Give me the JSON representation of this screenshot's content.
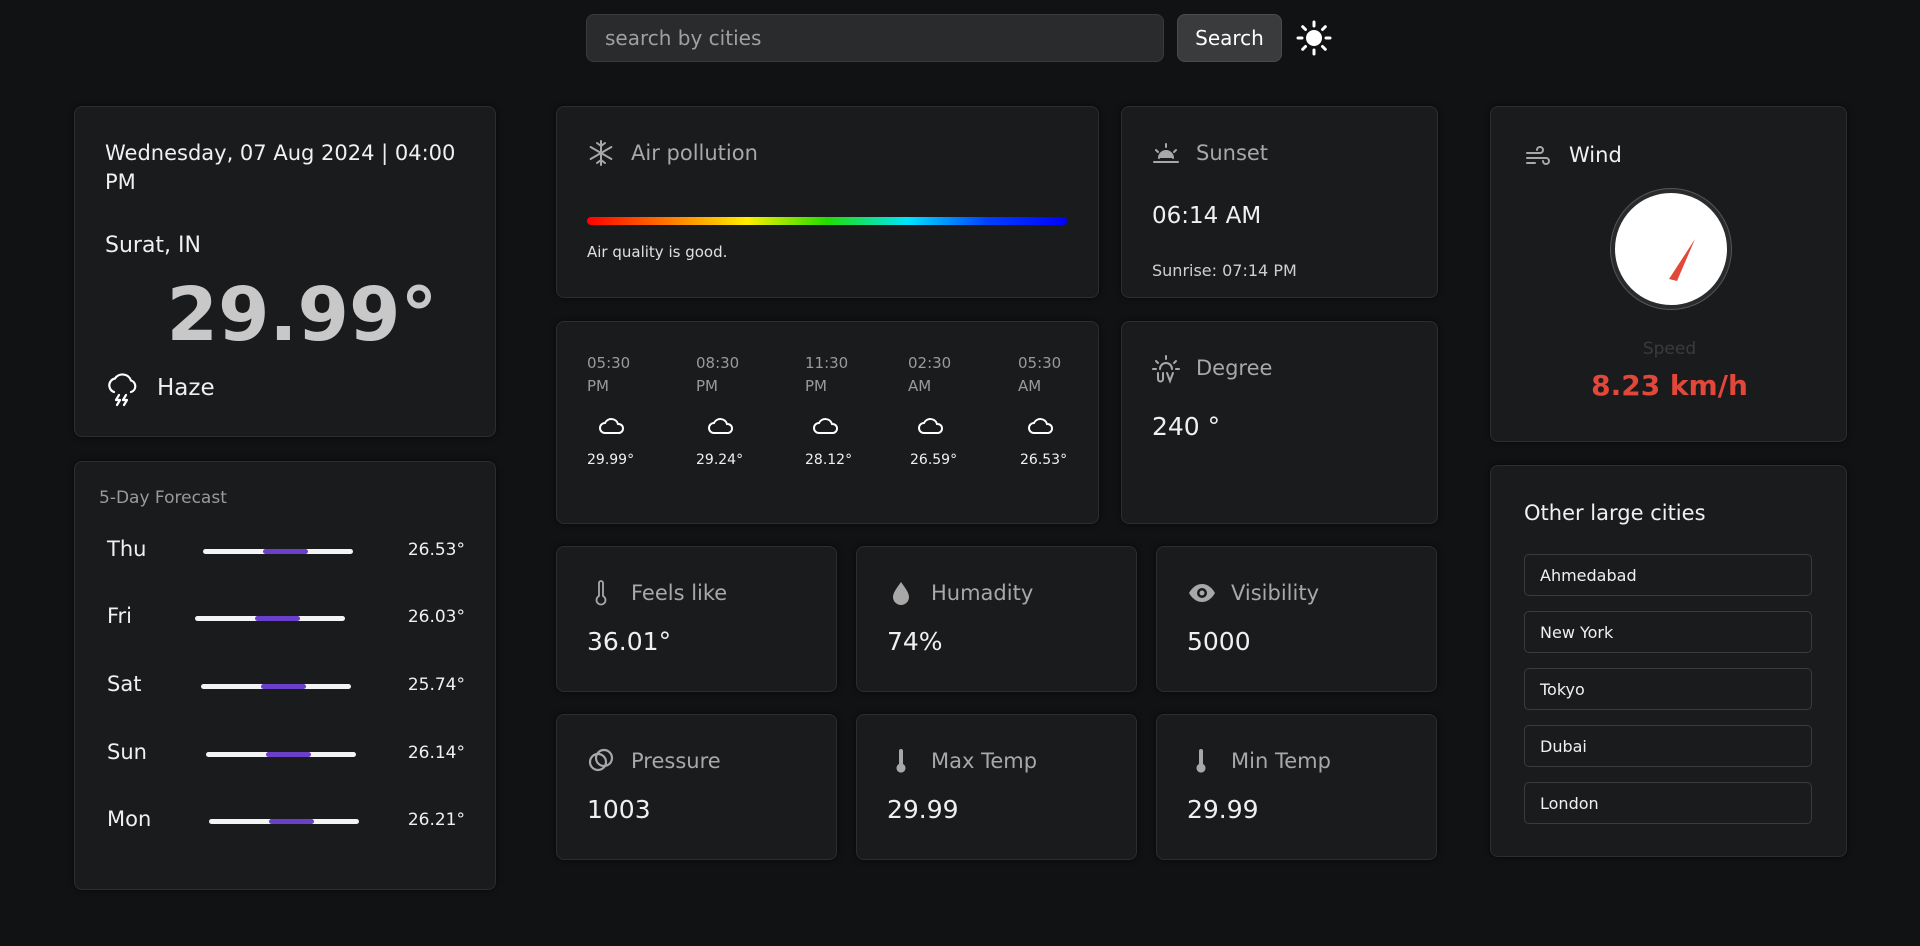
{
  "search": {
    "placeholder": "search by cities",
    "button_label": "Search"
  },
  "current": {
    "datetime": "Wednesday, 07 Aug 2024 | 04:00 PM",
    "location": "Surat, IN",
    "temperature": "29.99°",
    "condition": "Haze",
    "condition_icon": "cloud-storm-icon"
  },
  "forecast": {
    "title": "5-Day Forecast",
    "days": [
      {
        "day": "Thu",
        "temp": "26.53°"
      },
      {
        "day": "Fri",
        "temp": "26.03°"
      },
      {
        "day": "Sat",
        "temp": "25.74°"
      },
      {
        "day": "Sun",
        "temp": "26.14°"
      },
      {
        "day": "Mon",
        "temp": "26.21°"
      }
    ]
  },
  "air": {
    "title": "Air pollution",
    "status": "Air quality is good."
  },
  "sunset": {
    "title": "Sunset",
    "time": "06:14 AM",
    "sunrise": "Sunrise: 07:14 PM"
  },
  "hourly": [
    {
      "time1": "05:30",
      "time2": "PM",
      "temp": "29.99°"
    },
    {
      "time1": "08:30",
      "time2": "PM",
      "temp": "29.24°"
    },
    {
      "time1": "11:30",
      "time2": "PM",
      "temp": "28.12°"
    },
    {
      "time1": "02:30",
      "time2": "AM",
      "temp": "26.59°"
    },
    {
      "time1": "05:30",
      "time2": "AM",
      "temp": "26.53°"
    }
  ],
  "degree": {
    "title": "Degree",
    "value": "240 °"
  },
  "stats": {
    "feels_like": {
      "title": "Feels like",
      "value": "36.01°"
    },
    "humidity": {
      "title": "Humadity",
      "value": "74%"
    },
    "visibility": {
      "title": "Visibility",
      "value": "5000"
    },
    "pressure": {
      "title": "Pressure",
      "value": "1003"
    },
    "max_temp": {
      "title": "Max Temp",
      "value": "29.99"
    },
    "min_temp": {
      "title": "Min Temp",
      "value": "29.99"
    }
  },
  "wind": {
    "title": "Wind",
    "speed_label": "Speed",
    "speed": "8.23 km/h"
  },
  "cities": {
    "title": "Other large cities",
    "items": [
      "Ahmedabad",
      "New York",
      "Tokyo",
      "Dubai",
      "London"
    ]
  },
  "colors": {
    "background": "#111213",
    "card": "#1a1b1d",
    "accent_purple": "#6a3fc9",
    "wind_red": "#e2473a"
  }
}
